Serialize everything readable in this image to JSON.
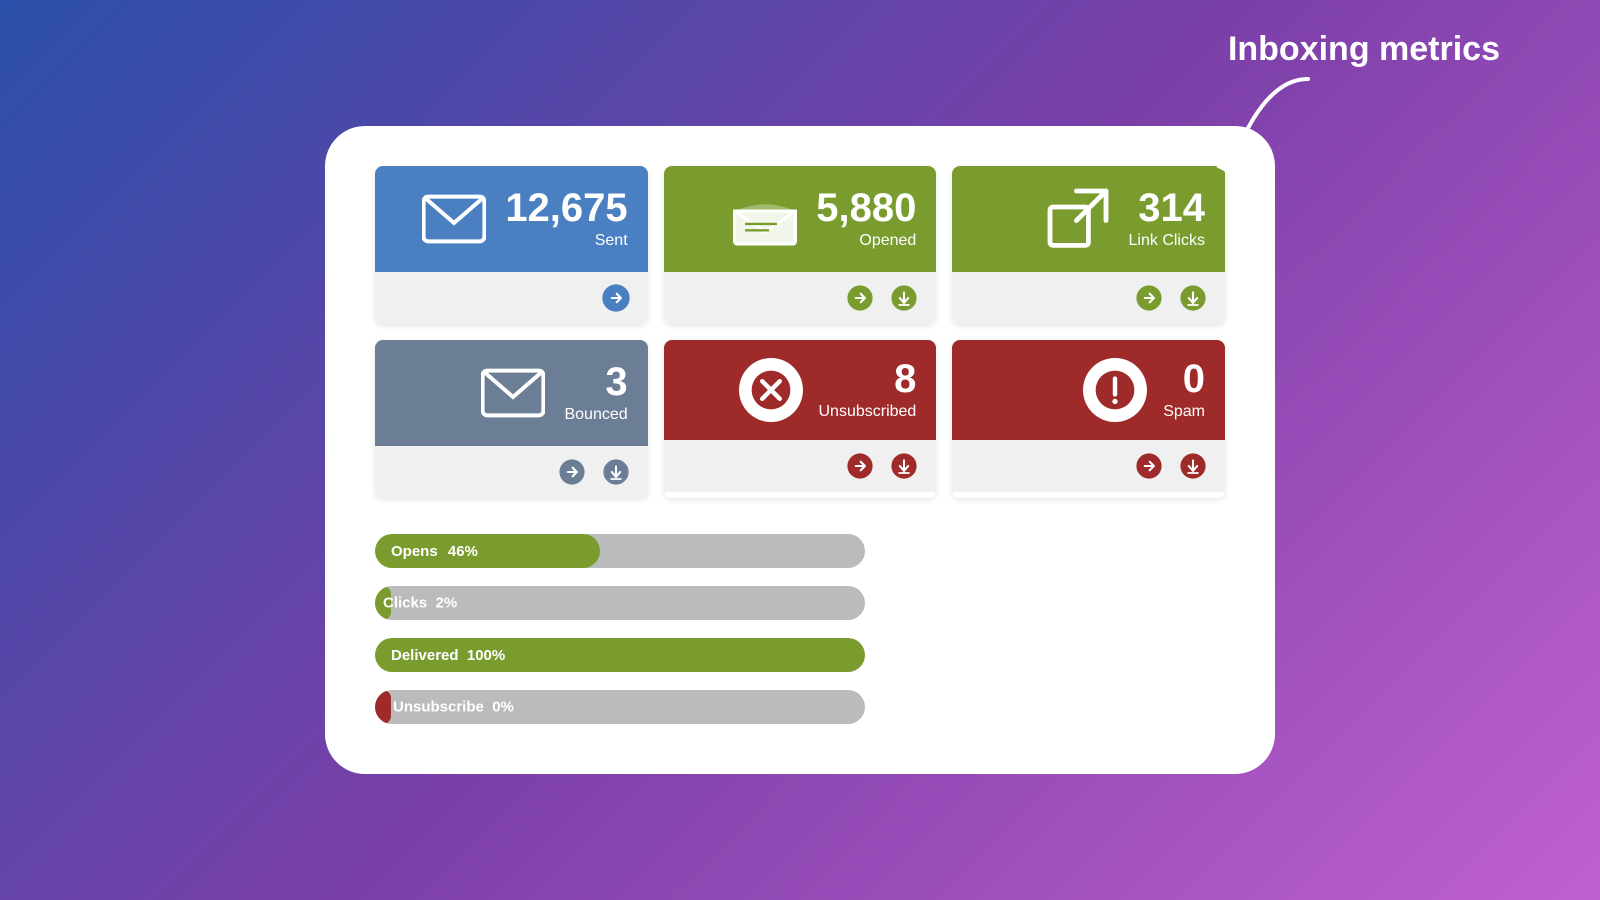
{
  "annotation": {
    "label": "Inboxing metrics"
  },
  "cards": [
    {
      "id": "sent",
      "color": "blue",
      "number": "12,675",
      "label": "Sent",
      "icon": "envelope",
      "actions": [
        "arrow-right"
      ],
      "hasDownload": false
    },
    {
      "id": "opened",
      "color": "olive",
      "number": "5,880",
      "label": "Opened",
      "icon": "envelope-open",
      "actions": [
        "arrow-right",
        "download"
      ],
      "hasDownload": true
    },
    {
      "id": "link-clicks",
      "color": "olive",
      "number": "314",
      "label": "Link Clicks",
      "icon": "external-link",
      "actions": [
        "arrow-right",
        "download"
      ],
      "hasDownload": true
    },
    {
      "id": "bounced",
      "color": "gray-slate",
      "number": "3",
      "label": "Bounced",
      "icon": "envelope",
      "actions": [
        "arrow-right",
        "download"
      ],
      "hasDownload": true
    },
    {
      "id": "unsubscribed",
      "color": "dark-red",
      "number": "8",
      "label": "Unsubscribed",
      "icon": "x-circle",
      "actions": [
        "arrow-right",
        "download"
      ],
      "hasDownload": true
    },
    {
      "id": "spam",
      "color": "dark-red",
      "number": "0",
      "label": "Spam",
      "icon": "exclamation-circle",
      "actions": [
        "arrow-right",
        "download"
      ],
      "hasDownload": true
    }
  ],
  "progress_bars": [
    {
      "label": "Opens",
      "percent": 46,
      "fill": "olive"
    },
    {
      "label": "Clicks",
      "percent": 2,
      "fill": "olive"
    },
    {
      "label": "Delivered",
      "percent": 100,
      "fill": "olive"
    },
    {
      "label": "Unsubscribe",
      "percent": 0,
      "fill": "red"
    }
  ]
}
